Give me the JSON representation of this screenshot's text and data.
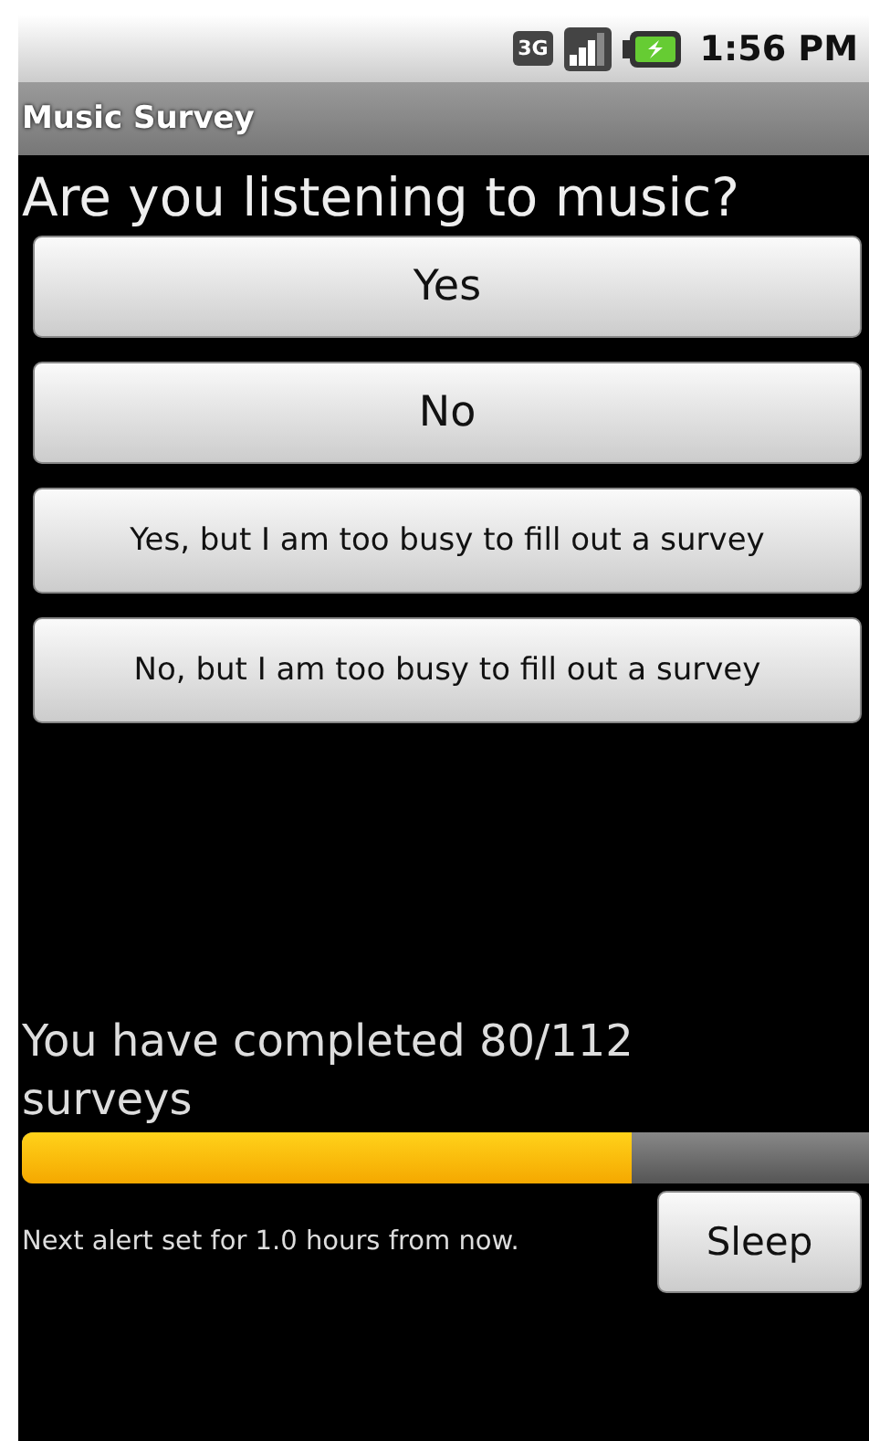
{
  "status_bar": {
    "time": "1:56 PM",
    "network": "3G"
  },
  "app_title": "Music Survey",
  "question": "Are you listening to music?",
  "answers": [
    "Yes",
    "No",
    "Yes, but I am too busy to fill out a survey",
    "No, but I am too busy to fill out a survey"
  ],
  "progress": {
    "text": "You have completed 80/112 surveys",
    "level": 0.72
  },
  "alert_text": "Next alert set for 1.0 hours from now.",
  "sleep_button": "Sleep"
}
